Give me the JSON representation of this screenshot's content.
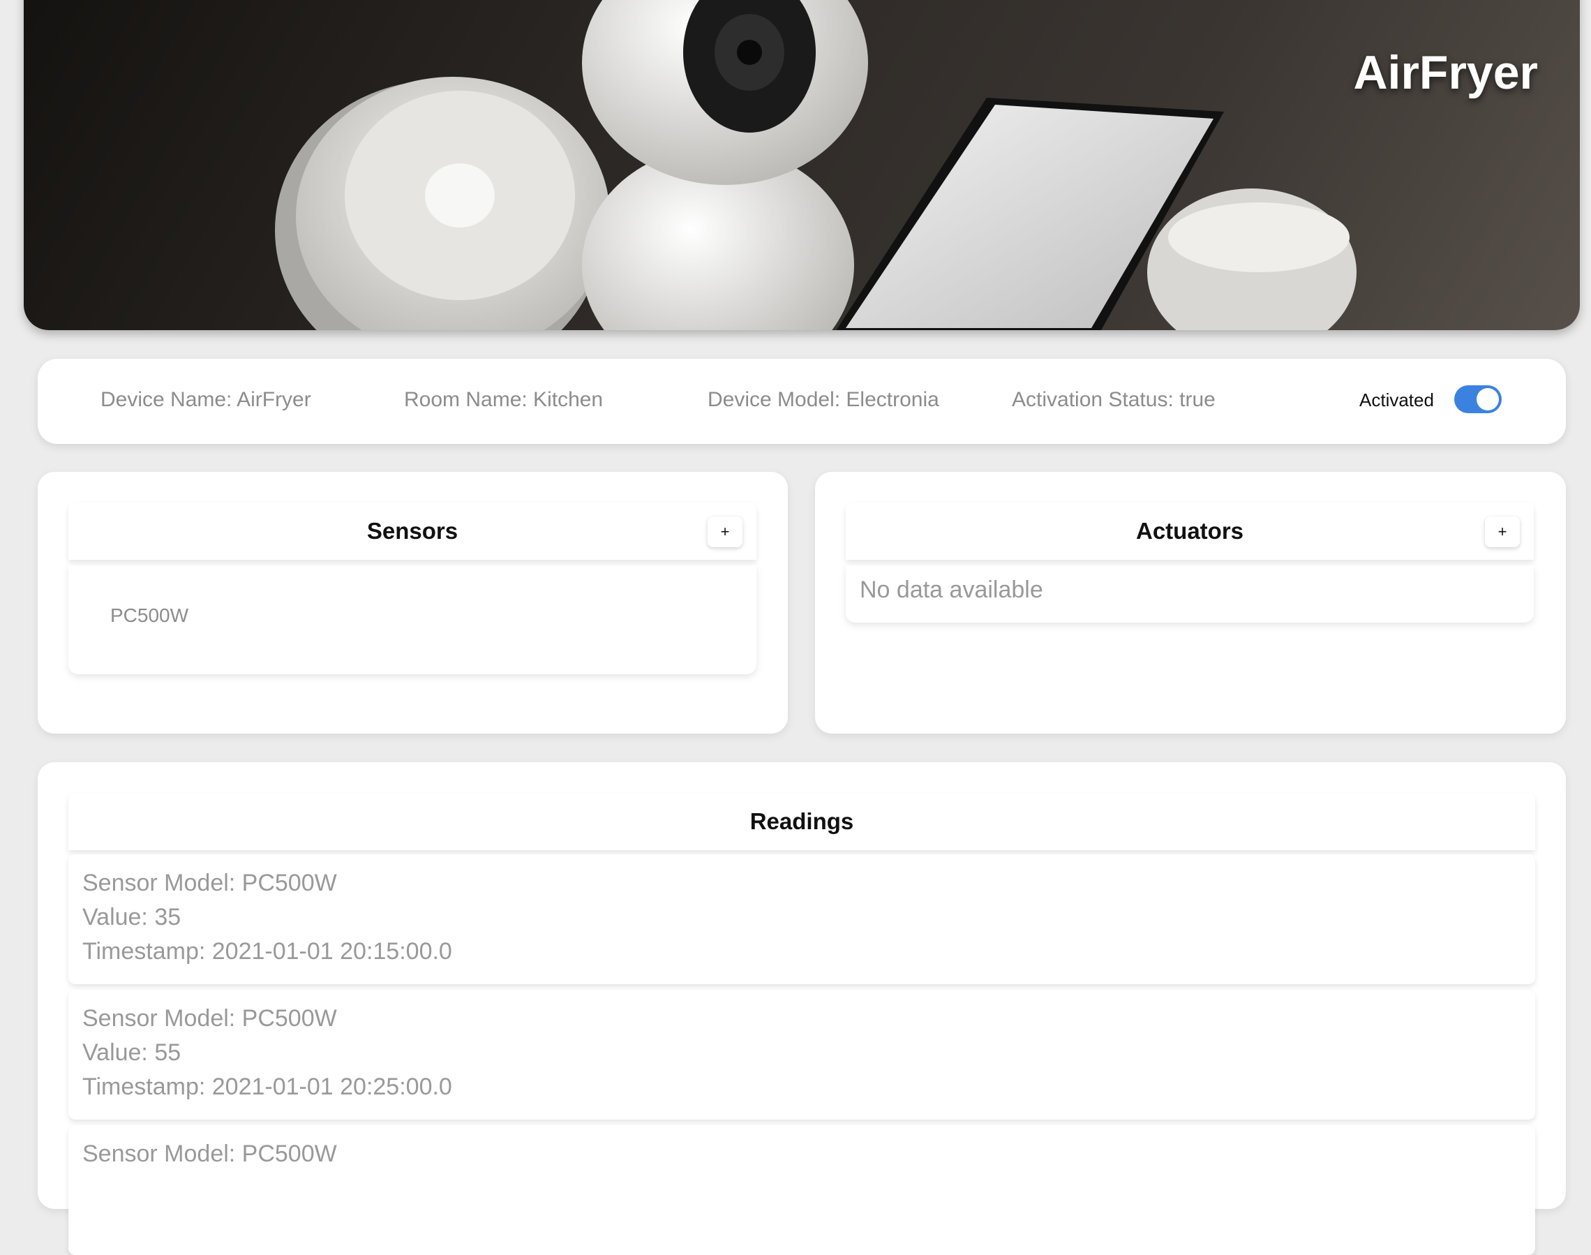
{
  "hero": {
    "title": "AirFryer"
  },
  "info": {
    "device_name": "Device Name: AirFryer",
    "room_name": "Room Name: Kitchen",
    "device_model": "Device Model: Electronia",
    "activation_status": "Activation Status: true",
    "toggle_label": "Activated",
    "toggle_on": true,
    "toggle_color": "#3b82e0"
  },
  "sensors": {
    "title": "Sensors",
    "add_label": "+",
    "items": [
      "PC500W"
    ]
  },
  "actuators": {
    "title": "Actuators",
    "add_label": "+",
    "empty_text": "No data available"
  },
  "readings": {
    "title": "Readings",
    "items": [
      {
        "model": "Sensor Model: PC500W",
        "value": "Value: 35",
        "timestamp": "Timestamp: 2021-01-01 20:15:00.0"
      },
      {
        "model": "Sensor Model: PC500W",
        "value": "Value: 55",
        "timestamp": "Timestamp: 2021-01-01 20:25:00.0"
      },
      {
        "model": "Sensor Model: PC500W"
      }
    ]
  }
}
